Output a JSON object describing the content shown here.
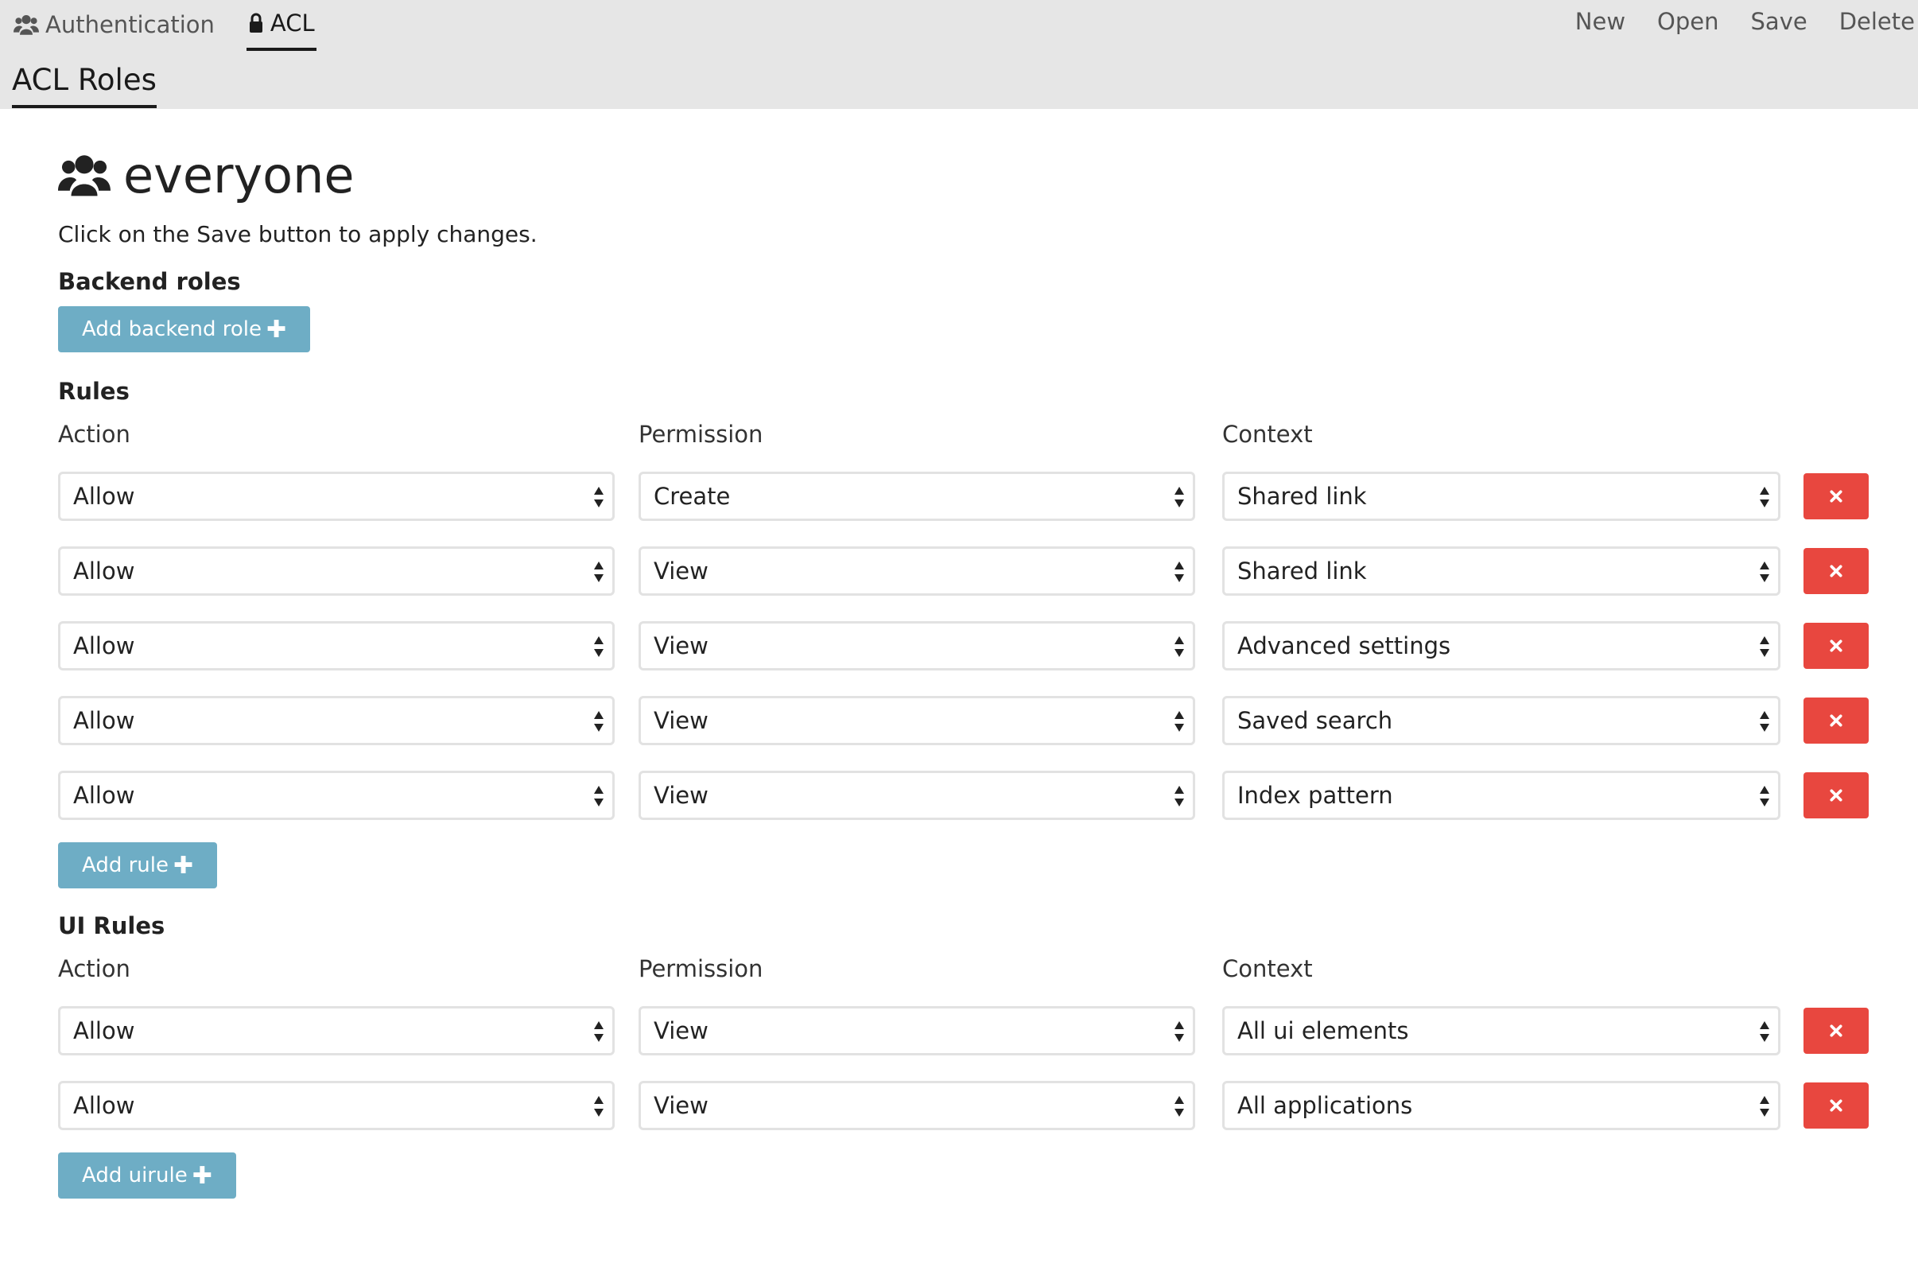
{
  "nav": {
    "tabs": [
      {
        "label": "Authentication",
        "icon": "users-icon"
      },
      {
        "label": "ACL",
        "icon": "lock-icon"
      }
    ],
    "actions": [
      "New",
      "Open",
      "Save",
      "Delete"
    ],
    "page_tab": "ACL Roles"
  },
  "role": {
    "name": "everyone",
    "hint": "Click on the Save button to apply changes."
  },
  "backend_roles": {
    "title": "Backend roles",
    "add_label": "Add backend role"
  },
  "rules": {
    "title": "Rules",
    "columns": [
      "Action",
      "Permission",
      "Context"
    ],
    "rows": [
      {
        "action": "Allow",
        "permission": "Create",
        "context": "Shared link"
      },
      {
        "action": "Allow",
        "permission": "View",
        "context": "Shared link"
      },
      {
        "action": "Allow",
        "permission": "View",
        "context": "Advanced settings"
      },
      {
        "action": "Allow",
        "permission": "View",
        "context": "Saved search"
      },
      {
        "action": "Allow",
        "permission": "View",
        "context": "Index pattern"
      }
    ],
    "add_label": "Add rule"
  },
  "ui_rules": {
    "title": "UI Rules",
    "columns": [
      "Action",
      "Permission",
      "Context"
    ],
    "rows": [
      {
        "action": "Allow",
        "permission": "View",
        "context": "All ui elements"
      },
      {
        "action": "Allow",
        "permission": "View",
        "context": "All applications"
      }
    ],
    "add_label": "Add uirule"
  },
  "colors": {
    "topbar_bg": "#e6e6e6",
    "add_button": "#6eadc5",
    "delete_button": "#e8473f"
  }
}
